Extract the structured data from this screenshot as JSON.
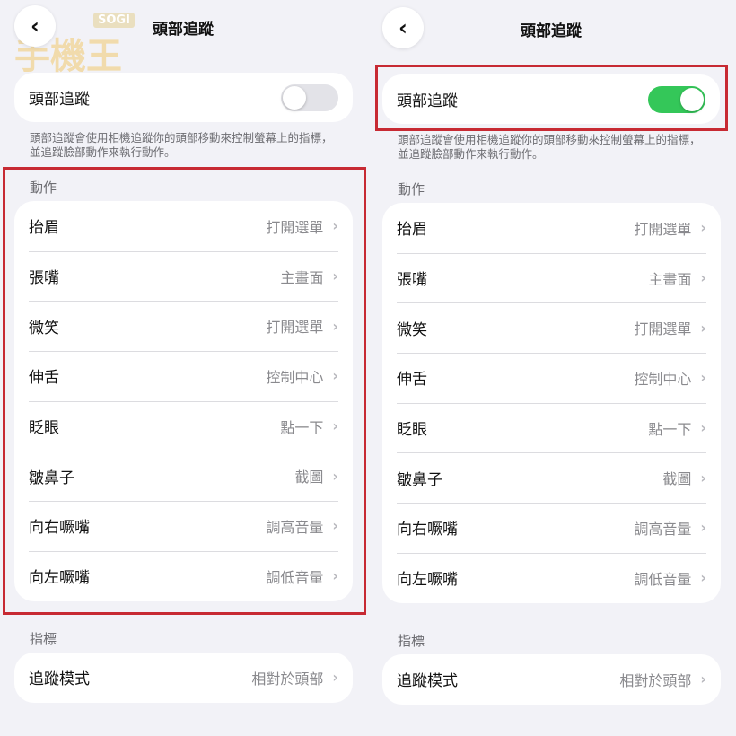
{
  "watermark": {
    "badge": "SOGI",
    "text": "手機王"
  },
  "nav": {
    "back_glyph": "‹",
    "title": "頭部追蹤"
  },
  "toggle": {
    "label": "頭部追蹤"
  },
  "description": "頭部追蹤會使用相機追蹤你的頭部移動來控制螢幕上的指標，並追蹤臉部動作來執行動作。",
  "actions": {
    "header": "動作",
    "items": [
      {
        "label": "抬眉",
        "value": "打開選單"
      },
      {
        "label": "張嘴",
        "value": "主畫面"
      },
      {
        "label": "微笑",
        "value": "打開選單"
      },
      {
        "label": "伸舌",
        "value": "控制中心"
      },
      {
        "label": "眨眼",
        "value": "點一下"
      },
      {
        "label": "皺鼻子",
        "value": "截圖"
      },
      {
        "label": "向右噘嘴",
        "value": "調高音量"
      },
      {
        "label": "向左噘嘴",
        "value": "調低音量"
      }
    ]
  },
  "pointer": {
    "header": "指標",
    "items": [
      {
        "label": "追蹤模式",
        "value": "相對於頭部"
      }
    ]
  },
  "chevron_glyph": "›",
  "left_panel": {
    "toggle_on": false
  },
  "right_panel": {
    "toggle_on": true
  },
  "colors": {
    "toggle_on": "#34c759",
    "toggle_off": "#e3e3e8",
    "highlight": "#c72a33",
    "background": "#f2f2f7"
  }
}
